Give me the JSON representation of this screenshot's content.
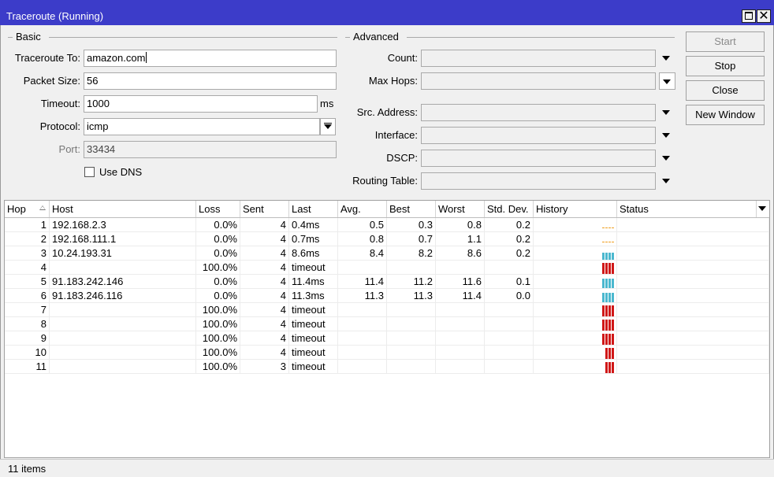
{
  "window": {
    "title": "Traceroute (Running)"
  },
  "basic": {
    "group_label": "Basic",
    "traceroute_to_label": "Traceroute To:",
    "traceroute_to_value": "amazon.com",
    "packet_size_label": "Packet Size:",
    "packet_size_value": "56",
    "timeout_label": "Timeout:",
    "timeout_value": "1000",
    "timeout_unit": "ms",
    "protocol_label": "Protocol:",
    "protocol_value": "icmp",
    "port_label": "Port:",
    "port_value": "33434",
    "use_dns_label": "Use DNS",
    "use_dns_checked": false
  },
  "advanced": {
    "group_label": "Advanced",
    "count_label": "Count:",
    "max_hops_label": "Max Hops:",
    "src_address_label": "Src. Address:",
    "interface_label": "Interface:",
    "dscp_label": "DSCP:",
    "routing_table_label": "Routing Table:"
  },
  "buttons": {
    "start": "Start",
    "stop": "Stop",
    "close": "Close",
    "new_window": "New Window"
  },
  "table": {
    "columns": [
      "Hop",
      "Host",
      "Loss",
      "Sent",
      "Last",
      "Avg.",
      "Best",
      "Worst",
      "Std. Dev.",
      "History",
      "Status"
    ],
    "rows": [
      {
        "hop": "1",
        "host": "192.168.2.3",
        "loss": "0.0%",
        "sent": "4",
        "last": "0.4ms",
        "avg": "0.5",
        "best": "0.3",
        "worst": "0.8",
        "std": "0.2",
        "history": "ok-low",
        "status": ""
      },
      {
        "hop": "2",
        "host": "192.168.111.1",
        "loss": "0.0%",
        "sent": "4",
        "last": "0.7ms",
        "avg": "0.8",
        "best": "0.7",
        "worst": "1.1",
        "std": "0.2",
        "history": "ok-low",
        "status": ""
      },
      {
        "hop": "3",
        "host": "10.24.193.31",
        "loss": "0.0%",
        "sent": "4",
        "last": "8.6ms",
        "avg": "8.4",
        "best": "8.2",
        "worst": "8.6",
        "std": "0.2",
        "history": "ok-mid",
        "status": ""
      },
      {
        "hop": "4",
        "host": "",
        "loss": "100.0%",
        "sent": "4",
        "last": "timeout",
        "avg": "",
        "best": "",
        "worst": "",
        "std": "",
        "history": "loss-4",
        "status": ""
      },
      {
        "hop": "5",
        "host": "91.183.242.146",
        "loss": "0.0%",
        "sent": "4",
        "last": "11.4ms",
        "avg": "11.4",
        "best": "11.2",
        "worst": "11.6",
        "std": "0.1",
        "history": "ok-high",
        "status": ""
      },
      {
        "hop": "6",
        "host": "91.183.246.116",
        "loss": "0.0%",
        "sent": "4",
        "last": "11.3ms",
        "avg": "11.3",
        "best": "11.3",
        "worst": "11.4",
        "std": "0.0",
        "history": "ok-high",
        "status": ""
      },
      {
        "hop": "7",
        "host": "",
        "loss": "100.0%",
        "sent": "4",
        "last": "timeout",
        "avg": "",
        "best": "",
        "worst": "",
        "std": "",
        "history": "loss-4",
        "status": ""
      },
      {
        "hop": "8",
        "host": "",
        "loss": "100.0%",
        "sent": "4",
        "last": "timeout",
        "avg": "",
        "best": "",
        "worst": "",
        "std": "",
        "history": "loss-4",
        "status": ""
      },
      {
        "hop": "9",
        "host": "",
        "loss": "100.0%",
        "sent": "4",
        "last": "timeout",
        "avg": "",
        "best": "",
        "worst": "",
        "std": "",
        "history": "loss-4",
        "status": ""
      },
      {
        "hop": "10",
        "host": "",
        "loss": "100.0%",
        "sent": "4",
        "last": "timeout",
        "avg": "",
        "best": "",
        "worst": "",
        "std": "",
        "history": "loss-3",
        "status": ""
      },
      {
        "hop": "11",
        "host": "",
        "loss": "100.0%",
        "sent": "3",
        "last": "timeout",
        "avg": "",
        "best": "",
        "worst": "",
        "std": "",
        "history": "loss-3",
        "status": ""
      }
    ]
  },
  "colors": {
    "titlebar": "#3c3cc9",
    "history_ok": "#4bb8cf",
    "history_loss": "#d01818",
    "history_low": "#f0a020"
  },
  "statusbar": {
    "text": "11 items"
  }
}
